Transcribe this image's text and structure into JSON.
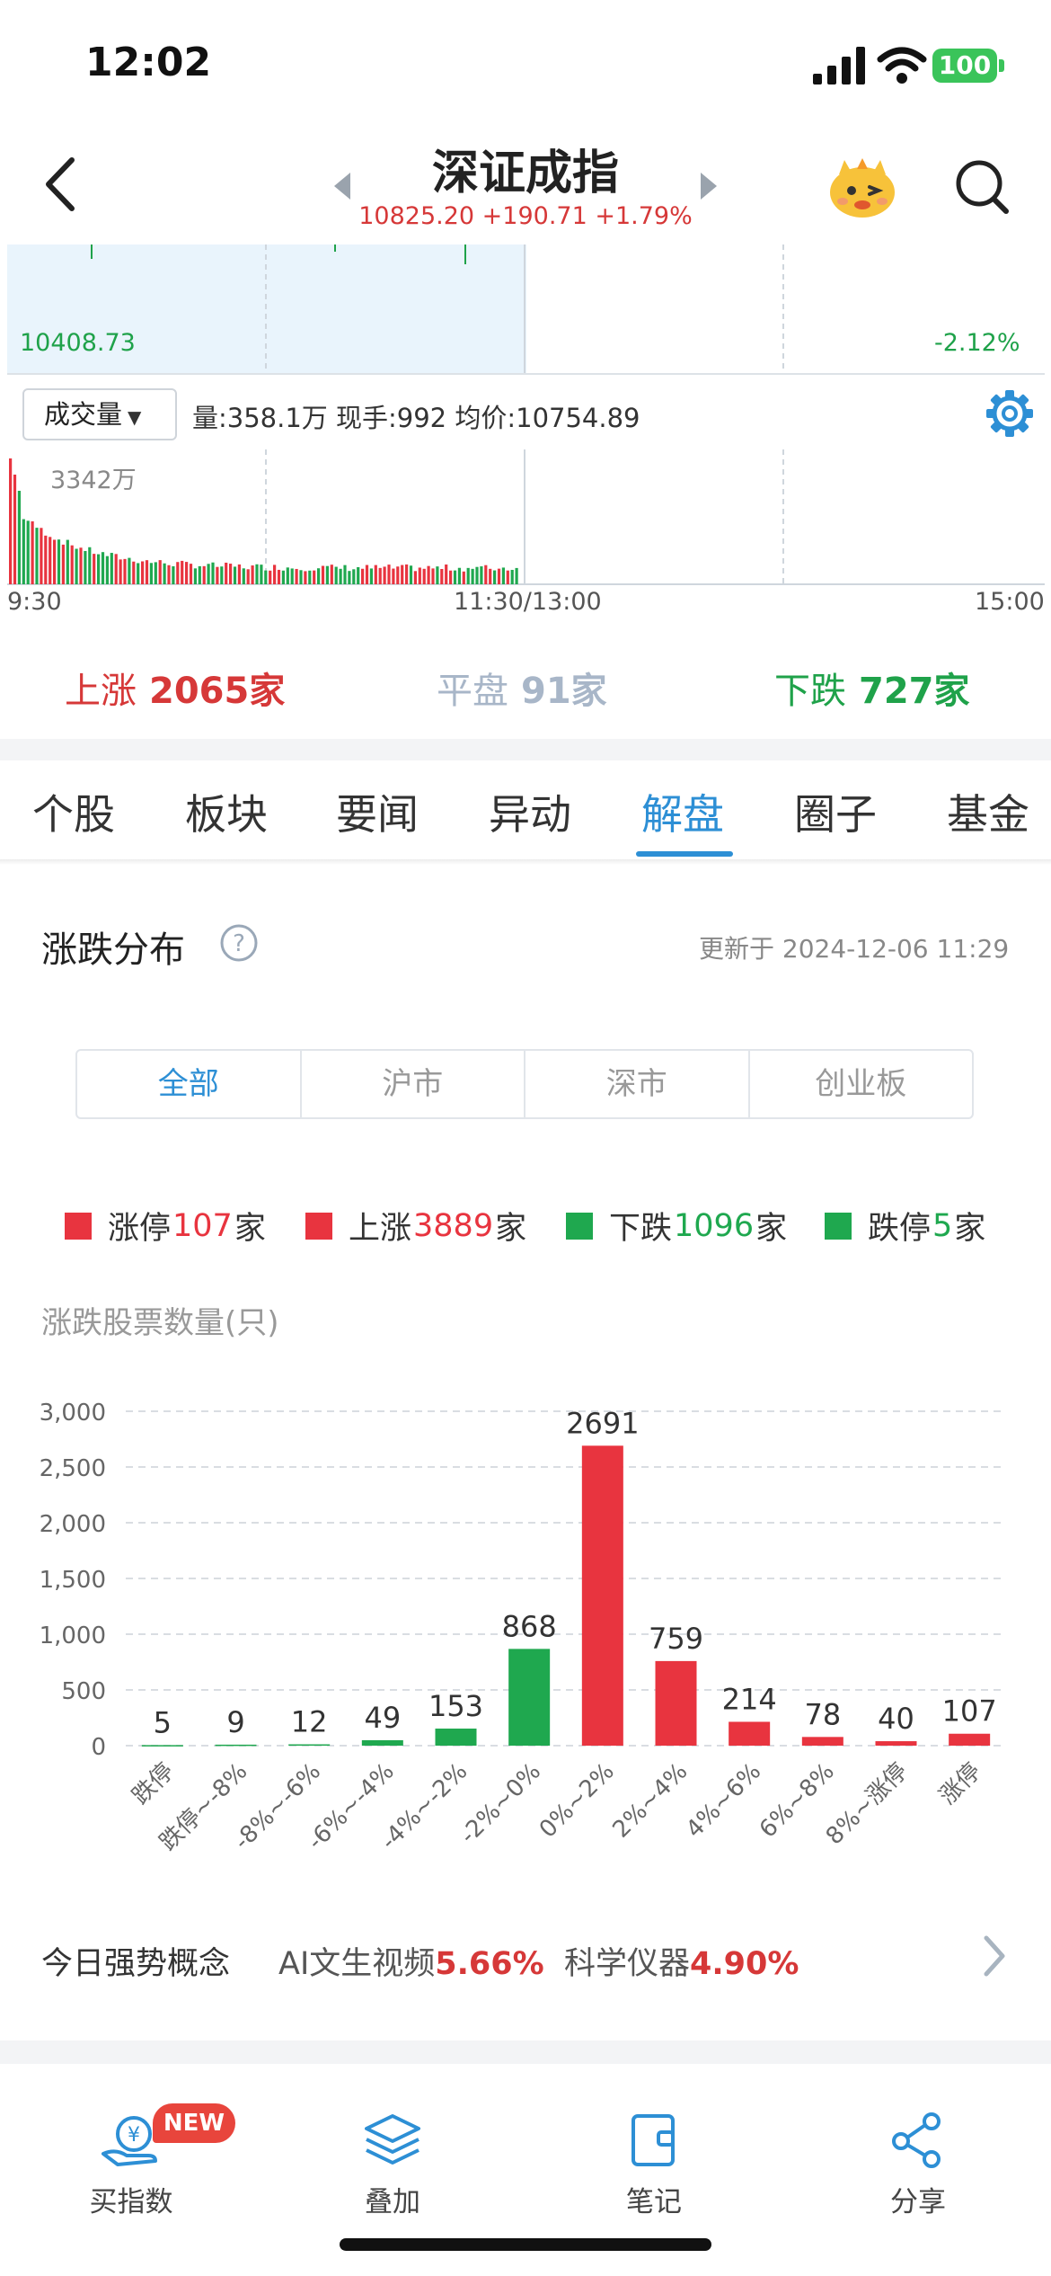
{
  "status": {
    "time": "12:02",
    "battery": "100"
  },
  "header": {
    "title": "深证成指",
    "quote": "10825.20 +190.71 +1.79%"
  },
  "price_chart": {
    "low_label": "10408.73",
    "pct_label": "-2.12%"
  },
  "volume": {
    "selector": "成交量",
    "info": "量:358.1万  现手:992  均价:10754.89",
    "max_label": "3342万",
    "time_labels": [
      "9:30",
      "11:30/13:00",
      "15:00"
    ]
  },
  "breadth": {
    "up_label": "上涨",
    "up_value": "2065家",
    "flat_label": "平盘",
    "flat_value": "91家",
    "down_label": "下跌",
    "down_value": "727家"
  },
  "tabs": [
    {
      "label": "个股"
    },
    {
      "label": "板块"
    },
    {
      "label": "要闻"
    },
    {
      "label": "异动"
    },
    {
      "label": "解盘"
    },
    {
      "label": "圈子"
    },
    {
      "label": "基金"
    }
  ],
  "active_tab": "解盘",
  "distribution": {
    "title": "涨跌分布",
    "updated": "更新于 2024-12-06 11:29",
    "segments": [
      "全部",
      "沪市",
      "深市",
      "创业板"
    ],
    "active_segment": "全部",
    "legend": [
      {
        "pre": "涨停",
        "num": "107",
        "post": "家",
        "color": "#e8343f"
      },
      {
        "pre": "上涨",
        "num": "3889",
        "post": "家",
        "color": "#e8343f"
      },
      {
        "pre": "下跌",
        "num": "1096",
        "post": "家",
        "color": "#1fa84f"
      },
      {
        "pre": "跌停",
        "num": "5",
        "post": "家",
        "color": "#1fa84f"
      }
    ],
    "chart_label": "涨跌股票数量(只)"
  },
  "chart_data": {
    "type": "bar",
    "categories": [
      "跌停",
      "跌停~-8%",
      "-8%~-6%",
      "-6%~-4%",
      "-4%~-2%",
      "-2%~0%",
      "0%~2%",
      "2%~4%",
      "4%~6%",
      "6%~8%",
      "8%~涨停",
      "涨停"
    ],
    "values": [
      5,
      9,
      12,
      49,
      153,
      868,
      2691,
      759,
      214,
      78,
      40,
      107
    ],
    "colors": [
      "#1fa84f",
      "#1fa84f",
      "#1fa84f",
      "#1fa84f",
      "#1fa84f",
      "#1fa84f",
      "#e8343f",
      "#e8343f",
      "#e8343f",
      "#e8343f",
      "#e8343f",
      "#e8343f"
    ],
    "y_ticks": [
      "3,000",
      "2,500",
      "2,000",
      "1,500",
      "1,000",
      "500",
      "0"
    ],
    "ylim": [
      0,
      3000
    ],
    "grid": true
  },
  "concepts": {
    "label": "今日强势概念",
    "items": [
      {
        "name": "AI文生视频",
        "value": "5.66%"
      },
      {
        "name": "科学仪器",
        "value": "4.90%"
      }
    ]
  },
  "toolbar": {
    "new_badge": "NEW",
    "items": [
      {
        "label": "买指数"
      },
      {
        "label": "叠加"
      },
      {
        "label": "笔记"
      },
      {
        "label": "分享"
      }
    ]
  }
}
